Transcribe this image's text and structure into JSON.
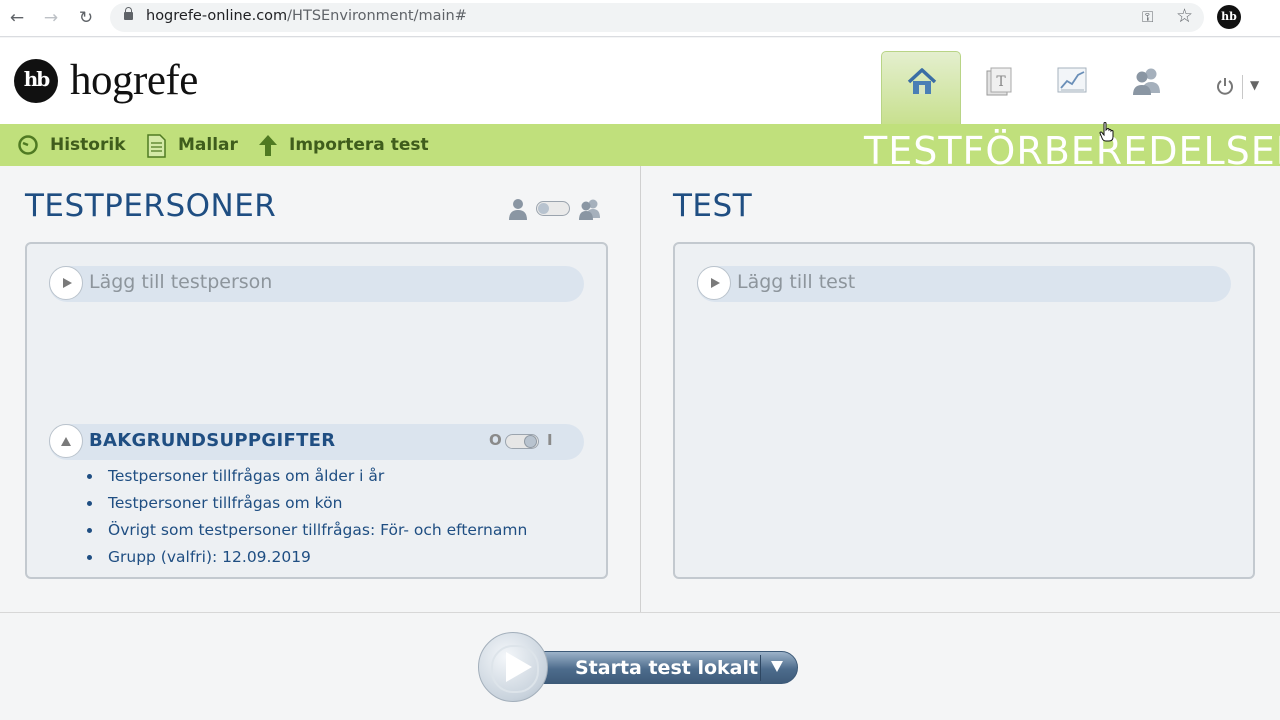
{
  "browser": {
    "url_host": "hogrefe-online.com",
    "url_path": "/HTSEnvironment/main#",
    "profile_initials": "hb"
  },
  "logo": {
    "mark": "hb",
    "name": "hogrefe"
  },
  "main_tabs": [
    {
      "name": "home",
      "icon": "home-icon",
      "active": true
    },
    {
      "name": "tests",
      "icon": "test-book-icon",
      "active": false
    },
    {
      "name": "results",
      "icon": "chart-icon",
      "active": false
    },
    {
      "name": "users",
      "icon": "users-icon",
      "active": false
    }
  ],
  "toolbar": {
    "historik": "Historik",
    "mallar": "Mallar",
    "importera": "Importera test",
    "section_title": "TESTFÖRBEREDELSER"
  },
  "left_panel": {
    "title": "TESTPERSONER",
    "add_label": "Lägg till testperson",
    "background": {
      "title": "BAKGRUNDSUPPGIFTER",
      "toggle_off": "O",
      "toggle_on": "I",
      "items": [
        "Testpersoner tillfrågas om ålder i år",
        "Testpersoner tillfrågas om kön",
        "Övrigt som testpersoner tillfrågas: För- och efternamn",
        "Grupp (valfri): 12.09.2019"
      ]
    }
  },
  "right_panel": {
    "title": "TEST",
    "add_label": "Lägg till test"
  },
  "start_button": {
    "label": "Starta test lokalt"
  },
  "colors": {
    "toolbar_green": "#c0e07c",
    "toolbar_text": "#3f5d1c",
    "title_blue": "#1f4e82",
    "button_blue": "#4d6c8c"
  }
}
